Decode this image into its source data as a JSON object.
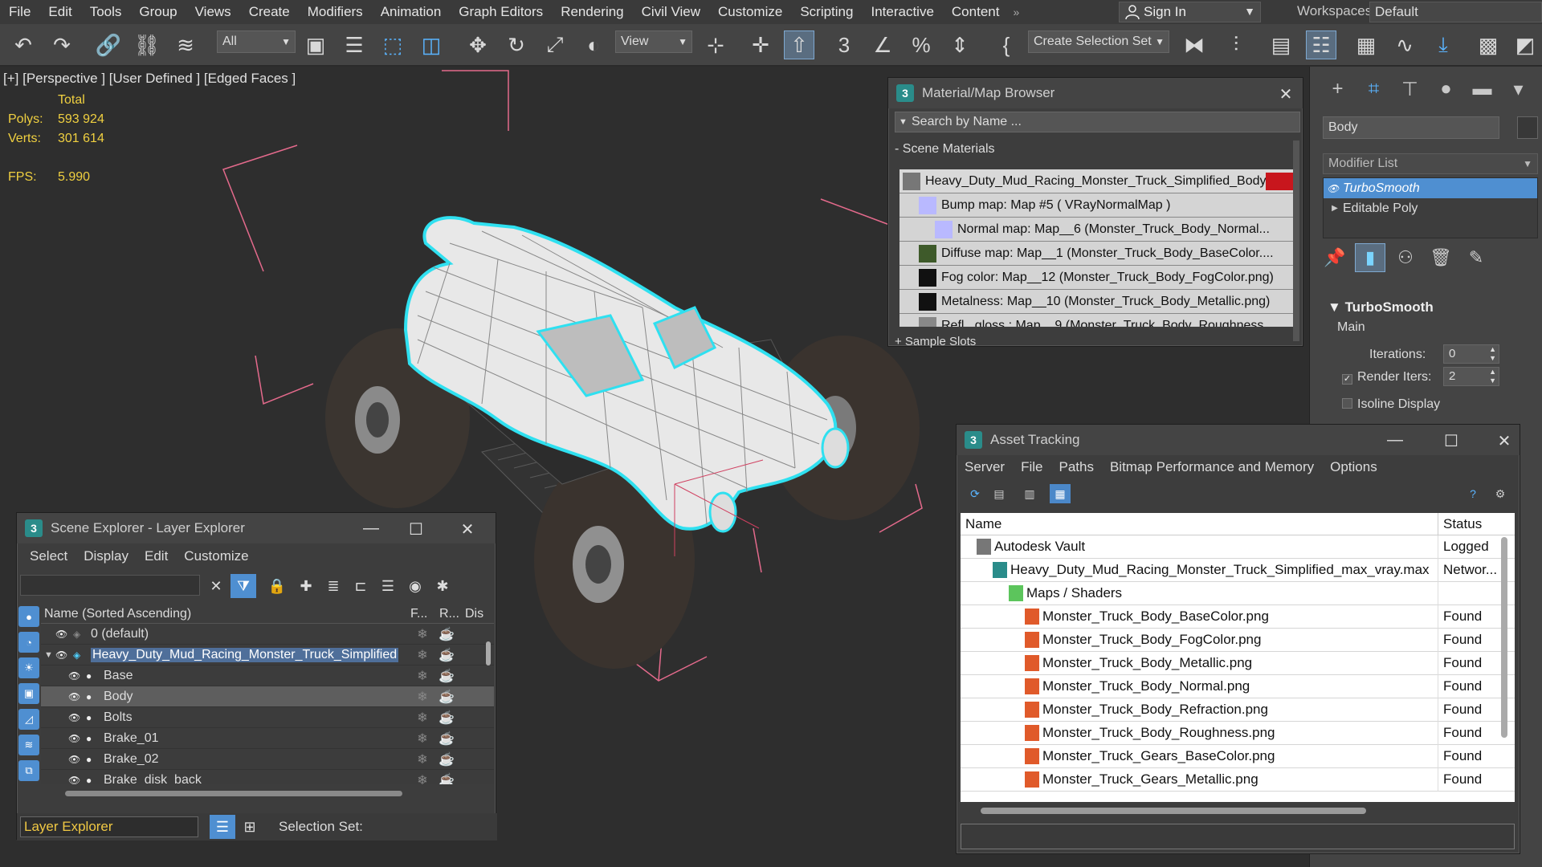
{
  "menubar": {
    "items": [
      "File",
      "Edit",
      "Tools",
      "Group",
      "Views",
      "Create",
      "Modifiers",
      "Animation",
      "Graph Editors",
      "Rendering",
      "Civil View",
      "Customize",
      "Scripting",
      "Interactive",
      "Content"
    ],
    "more": "»",
    "signin": "Sign In",
    "workspaces_label": "Workspaces:",
    "workspace_value": "Default"
  },
  "toolbar": {
    "selection_filter": "All",
    "ref_coord": "View",
    "selection_set_placeholder": "Create Selection Set"
  },
  "viewport": {
    "label": "[+] [Perspective ] [User Defined ] [Edged Faces ]",
    "stats": {
      "total_label": "Total",
      "polys_label": "Polys:",
      "polys_value": "593 924",
      "verts_label": "Verts:",
      "verts_value": "301 614",
      "fps_label": "FPS:",
      "fps_value": "5.990"
    }
  },
  "command_panel": {
    "object_name": "Body",
    "modifier_list_label": "Modifier List",
    "stack": [
      {
        "label": "TurboSmooth",
        "selected": true
      },
      {
        "label": "Editable Poly",
        "selected": false
      }
    ],
    "rollout_title": "TurboSmooth",
    "main_label": "Main",
    "iterations_label": "Iterations:",
    "iterations_value": "0",
    "render_iters_label": "Render Iters:",
    "render_iters_value": "2",
    "isoline_label": "Isoline Display"
  },
  "material_browser": {
    "title": "Material/Map Browser",
    "search_placeholder": "Search by Name ...",
    "section": "- Scene Materials",
    "rows": [
      "Heavy_Duty_Mud_Racing_Monster_Truck_Simplified_Body_...",
      "Bump map: Map #5  ( VRayNormalMap )",
      "Normal  map:  Map__6  (Monster_Truck_Body_Normal...",
      "Diffuse  map:  Map__1  (Monster_Truck_Body_BaseColor....",
      "Fog color: Map__12 (Monster_Truck_Body_FogColor.png)",
      "Metalness: Map__10 (Monster_Truck_Body_Metallic.png)",
      "Refl...gloss.:  Map__9  (Monster_Truck_Body_Roughness..."
    ],
    "sample_slots": "+ Sample Slots"
  },
  "asset_tracking": {
    "title": "Asset Tracking",
    "menu": [
      "Server",
      "File",
      "Paths",
      "Bitmap Performance and Memory",
      "Options"
    ],
    "columns": [
      "Name",
      "Status"
    ],
    "rows": [
      {
        "name": "Autodesk Vault",
        "status": "Logged",
        "indent": 1,
        "type": "vault"
      },
      {
        "name": "Heavy_Duty_Mud_Racing_Monster_Truck_Simplified_max_vray.max",
        "status": "Networ...",
        "indent": 2,
        "type": "max"
      },
      {
        "name": "Maps / Shaders",
        "status": "",
        "indent": 3,
        "type": "folder"
      },
      {
        "name": "Monster_Truck_Body_BaseColor.png",
        "status": "Found",
        "indent": 4,
        "type": "png"
      },
      {
        "name": "Monster_Truck_Body_FogColor.png",
        "status": "Found",
        "indent": 4,
        "type": "png"
      },
      {
        "name": "Monster_Truck_Body_Metallic.png",
        "status": "Found",
        "indent": 4,
        "type": "png"
      },
      {
        "name": "Monster_Truck_Body_Normal.png",
        "status": "Found",
        "indent": 4,
        "type": "png"
      },
      {
        "name": "Monster_Truck_Body_Refraction.png",
        "status": "Found",
        "indent": 4,
        "type": "png"
      },
      {
        "name": "Monster_Truck_Body_Roughness.png",
        "status": "Found",
        "indent": 4,
        "type": "png"
      },
      {
        "name": "Monster_Truck_Gears_BaseColor.png",
        "status": "Found",
        "indent": 4,
        "type": "png"
      },
      {
        "name": "Monster_Truck_Gears_Metallic.png",
        "status": "Found",
        "indent": 4,
        "type": "png"
      }
    ]
  },
  "scene_explorer": {
    "title": "Scene Explorer - Layer Explorer",
    "menu": [
      "Select",
      "Display",
      "Edit",
      "Customize"
    ],
    "columns": {
      "name": "Name (Sorted Ascending)",
      "freeze": "F...",
      "render": "R...",
      "display": "Dis"
    },
    "rows": [
      {
        "name": "0 (default)",
        "level": 0,
        "type": "layer",
        "selected": false
      },
      {
        "name": "Heavy_Duty_Mud_Racing_Monster_Truck_Simplified",
        "level": 0,
        "type": "layer-active",
        "selected": false
      },
      {
        "name": "Base",
        "level": 1,
        "type": "object",
        "selected": false
      },
      {
        "name": "Body",
        "level": 1,
        "type": "object",
        "selected": true
      },
      {
        "name": "Bolts",
        "level": 1,
        "type": "object",
        "selected": false
      },
      {
        "name": "Brake_01",
        "level": 1,
        "type": "object",
        "selected": false
      },
      {
        "name": "Brake_02",
        "level": 1,
        "type": "object",
        "selected": false
      },
      {
        "name": "Brake_disk_back",
        "level": 1,
        "type": "object",
        "selected": false
      }
    ],
    "bottom_dropdown": "Layer Explorer",
    "selection_set_label": "Selection Set:"
  },
  "colors": {
    "stats_yellow": "#f0d040",
    "selection_blue": "#4f8fd1",
    "wire_cyan": "#2fe0f0",
    "bbox_pink": "#e46a8c"
  }
}
